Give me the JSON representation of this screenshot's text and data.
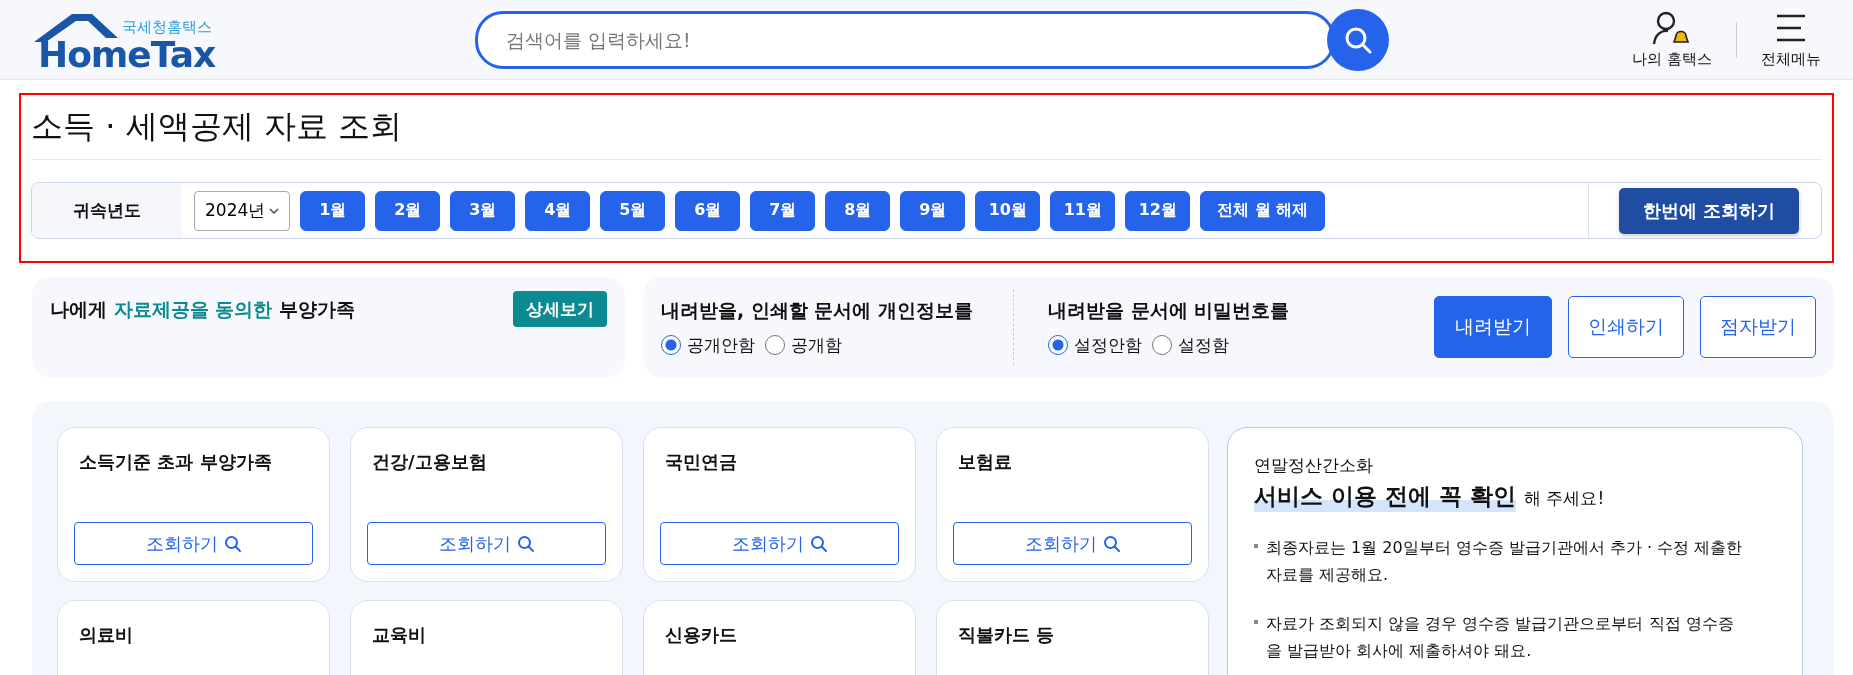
{
  "header": {
    "logo": {
      "subtitle": "국세청홈택스",
      "title": "HomeTax"
    },
    "search": {
      "placeholder": "검색어를 입력하세요!"
    },
    "menu": [
      {
        "label": "나의 홈택스",
        "kind": "account"
      },
      {
        "label": "전체메뉴",
        "kind": "menu"
      }
    ]
  },
  "page_title": "소득 · 세액공제 자료 조회",
  "filter": {
    "label": "귀속년도",
    "year": "2024년",
    "months": [
      {
        "label": "1월",
        "selected": true
      },
      {
        "label": "2월",
        "selected": true
      },
      {
        "label": "3월",
        "selected": true
      },
      {
        "label": "4월",
        "selected": true
      },
      {
        "label": "5월",
        "selected": true
      },
      {
        "label": "6월",
        "selected": true
      },
      {
        "label": "7월",
        "selected": true
      },
      {
        "label": "8월",
        "selected": true
      },
      {
        "label": "9월",
        "selected": true
      },
      {
        "label": "10월",
        "selected": true
      },
      {
        "label": "11월",
        "selected": true
      },
      {
        "label": "12월",
        "selected": true
      }
    ],
    "clear_button": "전체 월 해제",
    "submit_button": "한번에 조회하기"
  },
  "consent": {
    "before": "나에게",
    "highlight": "자료제공을 동의한",
    "after": "부양가족",
    "button": "상세보기"
  },
  "options": [
    {
      "title": "내려받을, 인쇄할 문서에 개인정보를",
      "radios": [
        {
          "label": "공개안함",
          "selected": true
        },
        {
          "label": "공개함",
          "selected": false
        }
      ]
    },
    {
      "title": "내려받을 문서에 비밀번호를",
      "radios": [
        {
          "label": "설정안함",
          "selected": true
        },
        {
          "label": "설정함",
          "selected": false
        }
      ]
    }
  ],
  "actions": [
    {
      "label": "내려받기",
      "primary": true
    },
    {
      "label": "인쇄하기",
      "primary": false
    },
    {
      "label": "점자받기",
      "primary": false
    }
  ],
  "categories": [
    {
      "title": "소득기준 초과 부양가족",
      "button": "조회하기"
    },
    {
      "title": "건강/고용보험",
      "button": "조회하기"
    },
    {
      "title": "국민연금",
      "button": "조회하기"
    },
    {
      "title": "보험료",
      "button": "조회하기"
    },
    {
      "title": "의료비"
    },
    {
      "title": "교육비"
    },
    {
      "title": "신용카드"
    },
    {
      "title": "직불카드 등"
    }
  ],
  "notice": {
    "subtitle": "연말정산간소화",
    "headline": "서비스 이용 전에 꼭 확인",
    "headline_suffix": "해 주세요!",
    "items": [
      "최종자료는 1월 20일부터 영수증 발급기관에서 추가 · 수정 제출한 자료를 제공해요.",
      "자료가 조회되지 않을 경우 영수증 발급기관으로부터 직접 영수증을 발급받아 회사에 제출하셔야 돼요."
    ]
  }
}
